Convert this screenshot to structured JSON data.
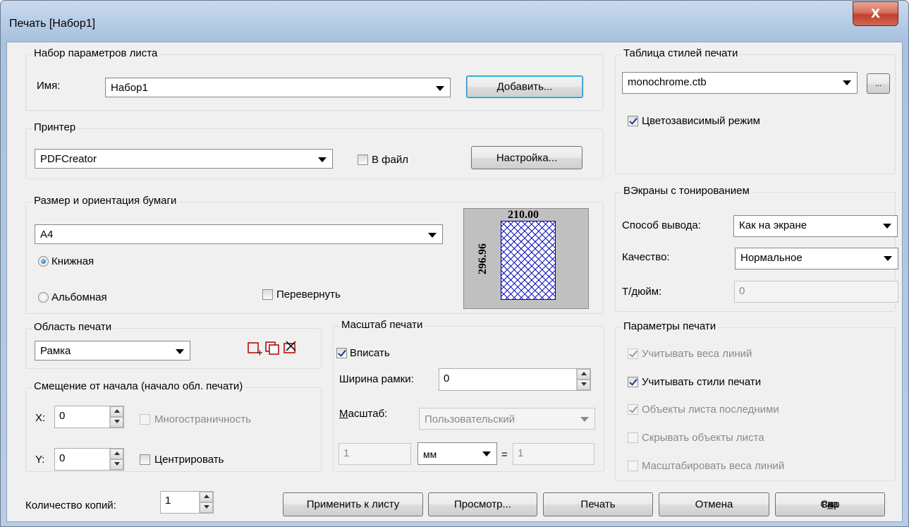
{
  "window": {
    "title": "Печать [Набор1]",
    "close_glyph": "X"
  },
  "page_setup": {
    "group_label": "Набор параметров листа",
    "name_label": "Имя:",
    "name_value": "Набор1",
    "add_button": "Добавить..."
  },
  "printer": {
    "group_label": "Принтер",
    "printer_value": "PDFCreator",
    "to_file_label": "В файл",
    "to_file_checked": false,
    "setup_button": "Настройка..."
  },
  "paper": {
    "group_label": "Размер и ориентация бумаги",
    "size_value": "A4",
    "portrait_label": "Книжная",
    "landscape_label": "Альбомная",
    "orientation": "portrait",
    "flip_label": "Перевернуть",
    "flip_checked": false,
    "preview_width": "210.00",
    "preview_height": "296.96"
  },
  "plot_area": {
    "group_label": "Область печати",
    "value": "Рамка"
  },
  "offset": {
    "group_label": "Смещение от начала (начало обл. печати)",
    "x_label": "X:",
    "x_value": "0",
    "y_label": "Y:",
    "y_value": "0",
    "multipage_label": "Многостраничность",
    "center_label": "Центрировать"
  },
  "scale": {
    "group_label": "Масштаб печати",
    "fit_label": "Вписать",
    "fit_checked": true,
    "frame_width_label": "Ширина рамки:",
    "frame_width_value": "0",
    "scale_label": "Масштаб:",
    "scale_value": "Пользовательский",
    "num_value": "1",
    "unit_value": "мм",
    "equals": "=",
    "den_value": "1"
  },
  "style_table": {
    "group_label": "Таблица стилей печати",
    "value": "monochrome.ctb",
    "browse_label": "...",
    "color_dependent_label": "Цветозависимый режим",
    "color_dependent_checked": true
  },
  "shaded": {
    "group_label": "ВЭкраны с тонированием",
    "output_label": "Способ вывода:",
    "output_value": "Как на экране",
    "quality_label": "Качество:",
    "quality_value": "Нормальное",
    "dpi_label": "Т/дюйм:",
    "dpi_value": "0"
  },
  "options": {
    "group_label": "Параметры печати",
    "items": [
      {
        "label": "Учитывать веса линий",
        "checked": true,
        "disabled": true
      },
      {
        "label": "Учитывать стили печати",
        "checked": true,
        "disabled": false
      },
      {
        "label": "Объекты листа последними",
        "checked": true,
        "disabled": true
      },
      {
        "label": "Скрывать объекты листа",
        "checked": false,
        "disabled": true
      },
      {
        "label": "Масштабировать веса линий",
        "checked": false,
        "disabled": true
      }
    ]
  },
  "copies": {
    "label": "Количество копий:",
    "value": "1"
  },
  "buttons": {
    "apply": "Применить к листу",
    "preview": "Просмотр...",
    "print": "Печать",
    "cancel": "Отмена",
    "help_pre": "Спр",
    "help_u": "а",
    "help_post": "вка"
  }
}
